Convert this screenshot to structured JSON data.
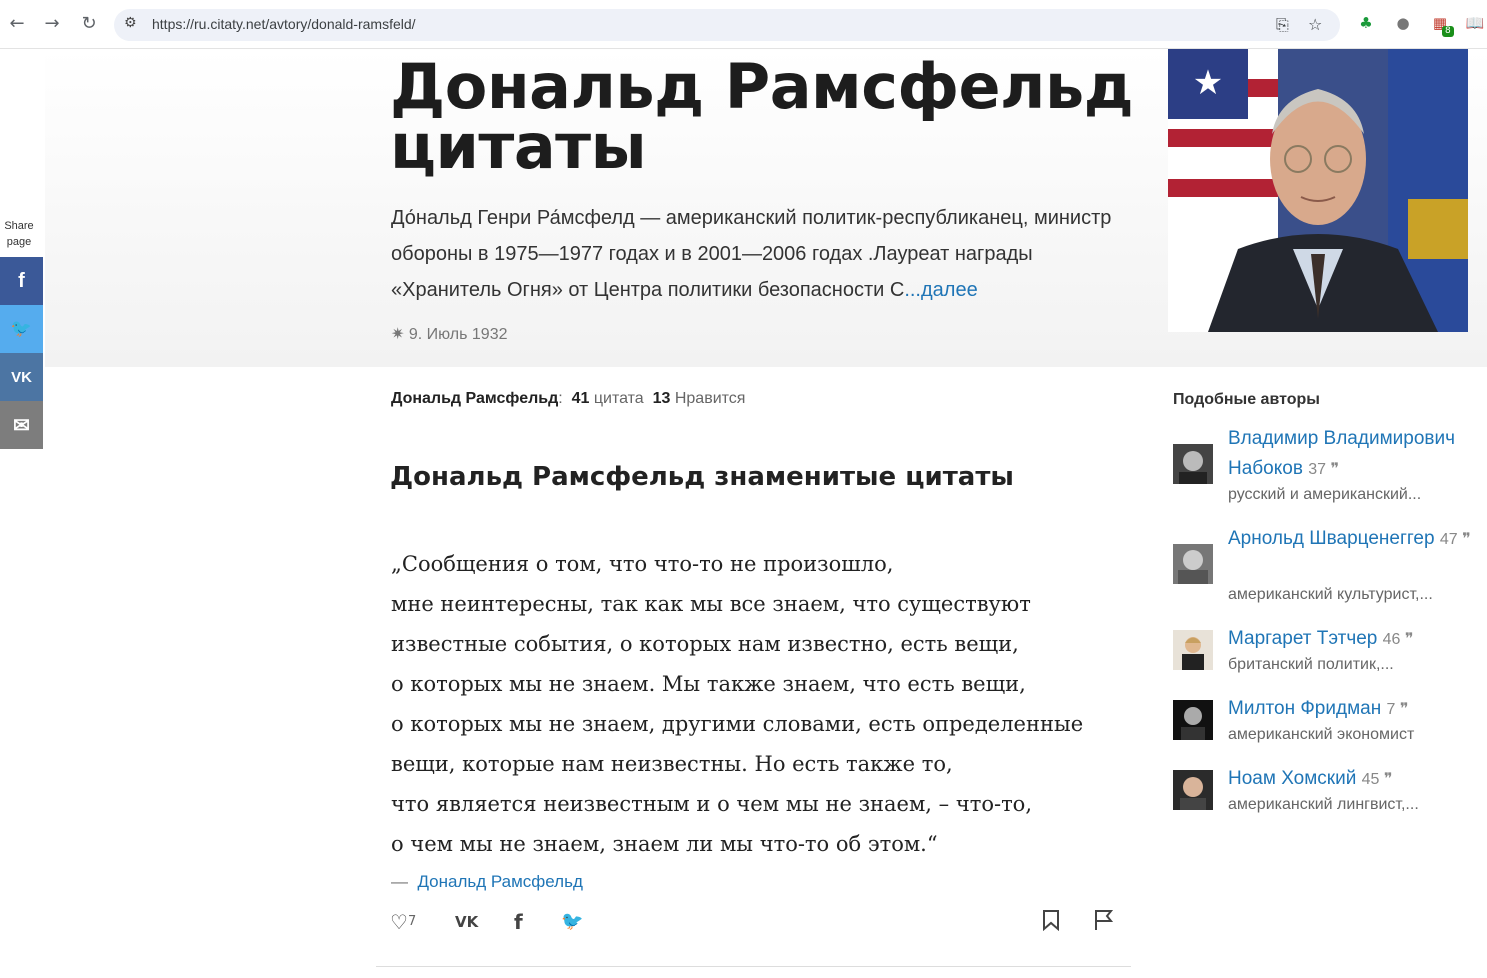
{
  "browser": {
    "url": "https://ru.citaty.net/avtory/donald-ramsfeld/",
    "extension_badge": "8"
  },
  "page": {
    "title_line1": "Дональд Рамсфельд",
    "title_line2": "цитаты",
    "bio": "До́нальд Генри Ра́мсфелд — американский политик-республиканец, министр обороны в 1975—1977 годах и в 2001—2006 годах .Лауреат награды «Хранитель Огня» от Центра политики безопасности С",
    "bio_more": "...далее",
    "birth": "✷ 9. Июль 1932"
  },
  "share": {
    "label": "Share page",
    "items": [
      {
        "icon": "facebook-icon",
        "glyph": "f",
        "color": "#3b5998"
      },
      {
        "icon": "twitter-icon",
        "glyph": "🐦",
        "color": "#55acee"
      },
      {
        "icon": "vk-icon",
        "glyph": "VK",
        "color": "#4c75a3"
      },
      {
        "icon": "email-icon",
        "glyph": "✉",
        "color": "#7d7d7d"
      }
    ]
  },
  "stats": {
    "author": "Дональд Рамсфельд",
    "quotes_count": "41",
    "quotes_label": "цитата",
    "likes_count": "13",
    "likes_label": "Нравится"
  },
  "section_title": "Дональд Рамсфельд знаменитые цитаты",
  "quote": {
    "text": "„Сообщения о том, что что-то не произошло,\nмне неинтересны, так как мы все знаем, что существуют\nизвестные события, о которых нам известно, есть вещи,\nо которых мы не знаем. Мы также знаем, что есть вещи,\nо которых мы не знаем, другими словами, есть определенные\nвещи, которые нам неизвестны. Но есть также то,\nчто является неизвестным и о чем мы не знаем, – что-то,\nо чем мы не знаем, знаем ли мы что-то об этом.“",
    "dash": "—",
    "author": "Дональд Рамсфельд",
    "likes": "7"
  },
  "similar": {
    "title": "Подобные авторы",
    "authors": [
      {
        "name": "Владимир Владимирович Набоков",
        "count": "37",
        "desc": "русский и американский..."
      },
      {
        "name": "Арнольд Шварценеггер",
        "count": "47",
        "desc": "американский культурист,..."
      },
      {
        "name": "Маргарет Тэтчер",
        "count": "46",
        "desc": "британский политик,..."
      },
      {
        "name": "Милтон Фридман",
        "count": "7",
        "desc": "американский экономист"
      },
      {
        "name": "Ноам Хомский",
        "count": "45",
        "desc": "американский лингвист,..."
      }
    ]
  }
}
